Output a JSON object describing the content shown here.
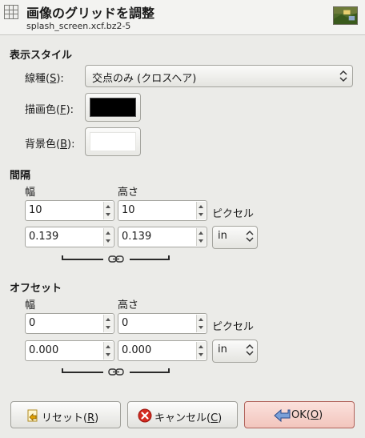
{
  "dialog": {
    "title": "画像のグリッドを調整",
    "subtitle": "splash_screen.xcf.bz2-5"
  },
  "appearance": {
    "heading": "表示スタイル",
    "line_style_label": "線種(",
    "line_style_mnemonic": "S",
    "line_style_label_end": "):",
    "line_style_value": "交点のみ (クロスヘア)",
    "fg_label": "描画色(",
    "fg_mnemonic": "F",
    "fg_label_end": "):",
    "fg_color": "#000000",
    "bg_label": "背景色(",
    "bg_mnemonic": "B",
    "bg_label_end": "):",
    "bg_color": "#ffffff"
  },
  "spacing": {
    "heading": "間隔",
    "width_label": "幅",
    "height_label": "高さ",
    "width_px": "10",
    "height_px": "10",
    "pixel_unit_label": "ピクセル",
    "width_in": "0.139",
    "height_in": "0.139",
    "unit_value": "in",
    "chain_linked": true
  },
  "offset": {
    "heading": "オフセット",
    "width_label": "幅",
    "height_label": "高さ",
    "width_px": "0",
    "height_px": "0",
    "pixel_unit_label": "ピクセル",
    "width_in": "0.000",
    "height_in": "0.000",
    "unit_value": "in",
    "chain_linked": true
  },
  "buttons": {
    "reset_label": "リセット(",
    "reset_mnemonic": "R",
    "reset_end": ")",
    "cancel_label": "キャンセル(",
    "cancel_mnemonic": "C",
    "cancel_end": ")",
    "ok_label": "OK(",
    "ok_mnemonic": "O",
    "ok_end": ")"
  },
  "colors": {
    "ok_accent": "#f2c5bd",
    "cancel_icon": "#d42a20"
  }
}
